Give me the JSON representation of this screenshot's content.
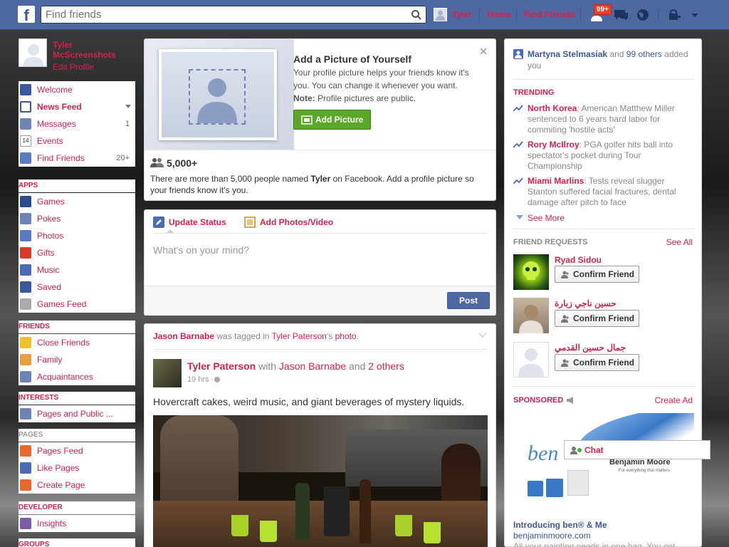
{
  "topbar": {
    "logo": "f",
    "search_placeholder": "Find friends",
    "user_name": "Tyler",
    "home": "Home",
    "find_friends": "Find Friends",
    "notif_count": "99+"
  },
  "sidebar": {
    "profile_name": "Tyler McScreenshots",
    "edit_profile": "Edit Profile",
    "favorites": [
      {
        "label": "Welcome",
        "count": ""
      },
      {
        "label": "News Feed",
        "count": ""
      },
      {
        "label": "Messages",
        "count": "1"
      },
      {
        "label": "Events",
        "count": ""
      },
      {
        "label": "Find Friends",
        "count": "20+"
      }
    ],
    "apps_head": "APPS",
    "apps": [
      "Games",
      "Pokes",
      "Photos",
      "Gifts",
      "Music",
      "Saved",
      "Games Feed"
    ],
    "friends_head": "FRIENDS",
    "friends": [
      "Close Friends",
      "Family",
      "Acquaintances"
    ],
    "interests_head": "INTERESTS",
    "interests": [
      "Pages and Public ..."
    ],
    "pages_head": "PAGES",
    "pages": [
      "Pages Feed",
      "Like Pages",
      "Create Page"
    ],
    "developer_head": "DEVELOPER",
    "developer": [
      "Insights"
    ],
    "groups_head": "GROUPS"
  },
  "profile_prompt": {
    "title": "Add a Picture of Yourself",
    "body": "Your profile picture helps your friends know it's you. You can change it whenever you want.",
    "note_label": "Note:",
    "note_text": " Profile pictures are public.",
    "button": "Add Picture",
    "count": "5,000+",
    "count_text_a": "There are more than 5,000 people named ",
    "count_name": "Tyler",
    "count_text_b": " on Facebook. Add a profile picture so your friends know it's you."
  },
  "composer": {
    "tab_status": "Update Status",
    "tab_photos": "Add Photos/Video",
    "placeholder": "What's on your mind?",
    "post": "Post"
  },
  "story": {
    "tagger": "Jason Barnabe",
    "tag_text": " was tagged in ",
    "owner": "Tyler Paterson",
    "photo_suffix": "'s ",
    "photo_word": "photo",
    "period": ".",
    "author": "Tyler Paterson",
    "with": " with ",
    "with_name": "Jason Barnabe",
    "and": " and ",
    "others": "2 others",
    "time": "19 hrs · ",
    "text": "Hovercraft cakes, weird music, and giant beverages of mystery liquids."
  },
  "right": {
    "activity_name": "Martyna Stelmasiak",
    "activity_and": " and ",
    "activity_others": "99 others",
    "activity_text": " added you",
    "trending_head": "TRENDING",
    "trends": [
      {
        "topic": "North Korea",
        "text": ": American Matthew Miller sentenced to 6 years hard labor for commiting 'hostile acts'"
      },
      {
        "topic": "Rory McIlroy",
        "text": ": PGA golfer hits ball into spectator's pocket during Tour Championship"
      },
      {
        "topic": "Miami Marlins",
        "text": ": Tests reveal slugger Stanton suffered facial fractures, dental damage after pitch to face"
      }
    ],
    "see_more": "See More",
    "fr_head": "FRIEND REQUESTS",
    "see_all": "See All",
    "requests": [
      {
        "name": "Ryad Sidou",
        "button": "Confirm Friend"
      },
      {
        "name": "حسين ناجي زبارة",
        "button": "Confirm Friend"
      },
      {
        "name": "جمال حسين القدمي",
        "button": "Confirm Friend"
      }
    ],
    "sponsored_head": "SPONSORED",
    "create_ad": "Create Ad",
    "ad_brand": "Benjamin Moore",
    "ad_tagline": "For everything that matters",
    "ad_ben": "ben",
    "ad_title": "Introducing ben® & Me",
    "ad_url": "benjaminmoore.com",
    "ad_desc": "All your painting needs in one bag. You get",
    "chat": "Chat"
  },
  "colors": {
    "topbar": "#4e69a2",
    "accent": "#d81f4b",
    "button_green": "#5ba829",
    "post_button": "#4e69a2"
  }
}
